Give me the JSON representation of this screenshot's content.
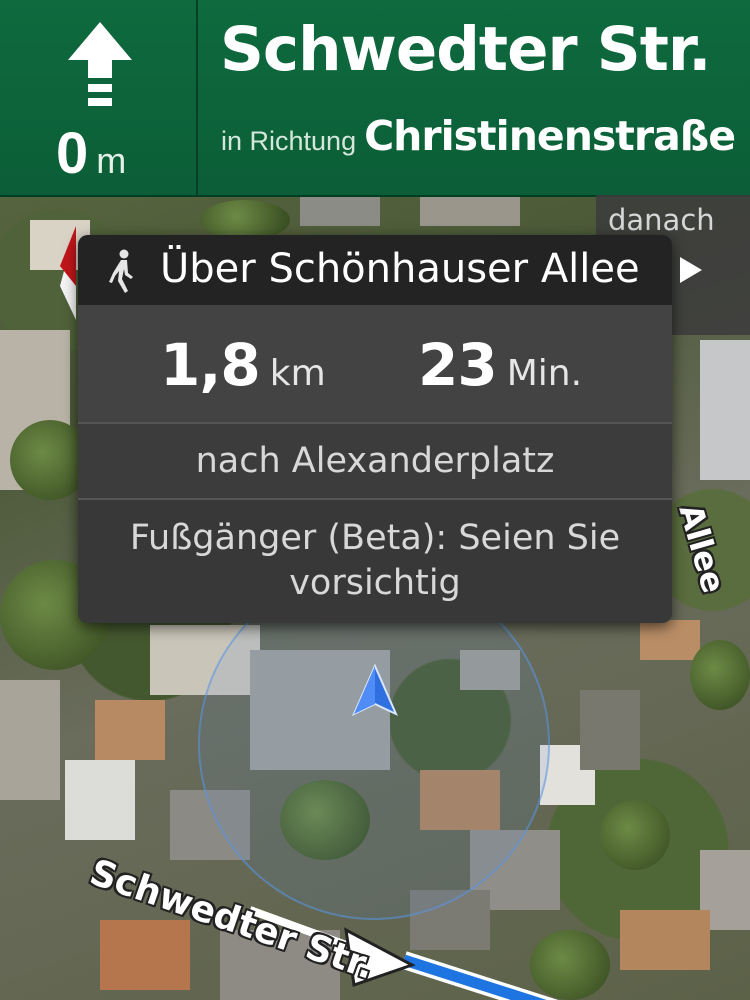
{
  "header": {
    "turn_icon": "straight-arrow-icon",
    "distance_value": "0",
    "distance_unit": "m",
    "street": "Schwedter Str.",
    "toward_prefix": "in Richtung",
    "toward_street": "Christinenstraße",
    "background_color": "#0b5e37"
  },
  "next_step": {
    "label": "danach",
    "icon": "play-arrow-icon"
  },
  "card": {
    "mode_icon": "pedestrian-icon",
    "route_name": "Über Schönhauser Allee",
    "distance_value": "1,8",
    "distance_unit": "km",
    "time_value": "23",
    "time_unit": "Min.",
    "destination": "nach Alexanderplatz",
    "warning_line1": "Fußgänger (Beta): Seien Sie",
    "warning_line2": "vorsichtig"
  },
  "map": {
    "street_label_1": "Schwedter Str.",
    "street_label_2": "Allee",
    "position_marker_icon": "navigation-arrow-icon",
    "compass_icon": "compass-needle-icon",
    "route_color": "#1e74e0"
  }
}
